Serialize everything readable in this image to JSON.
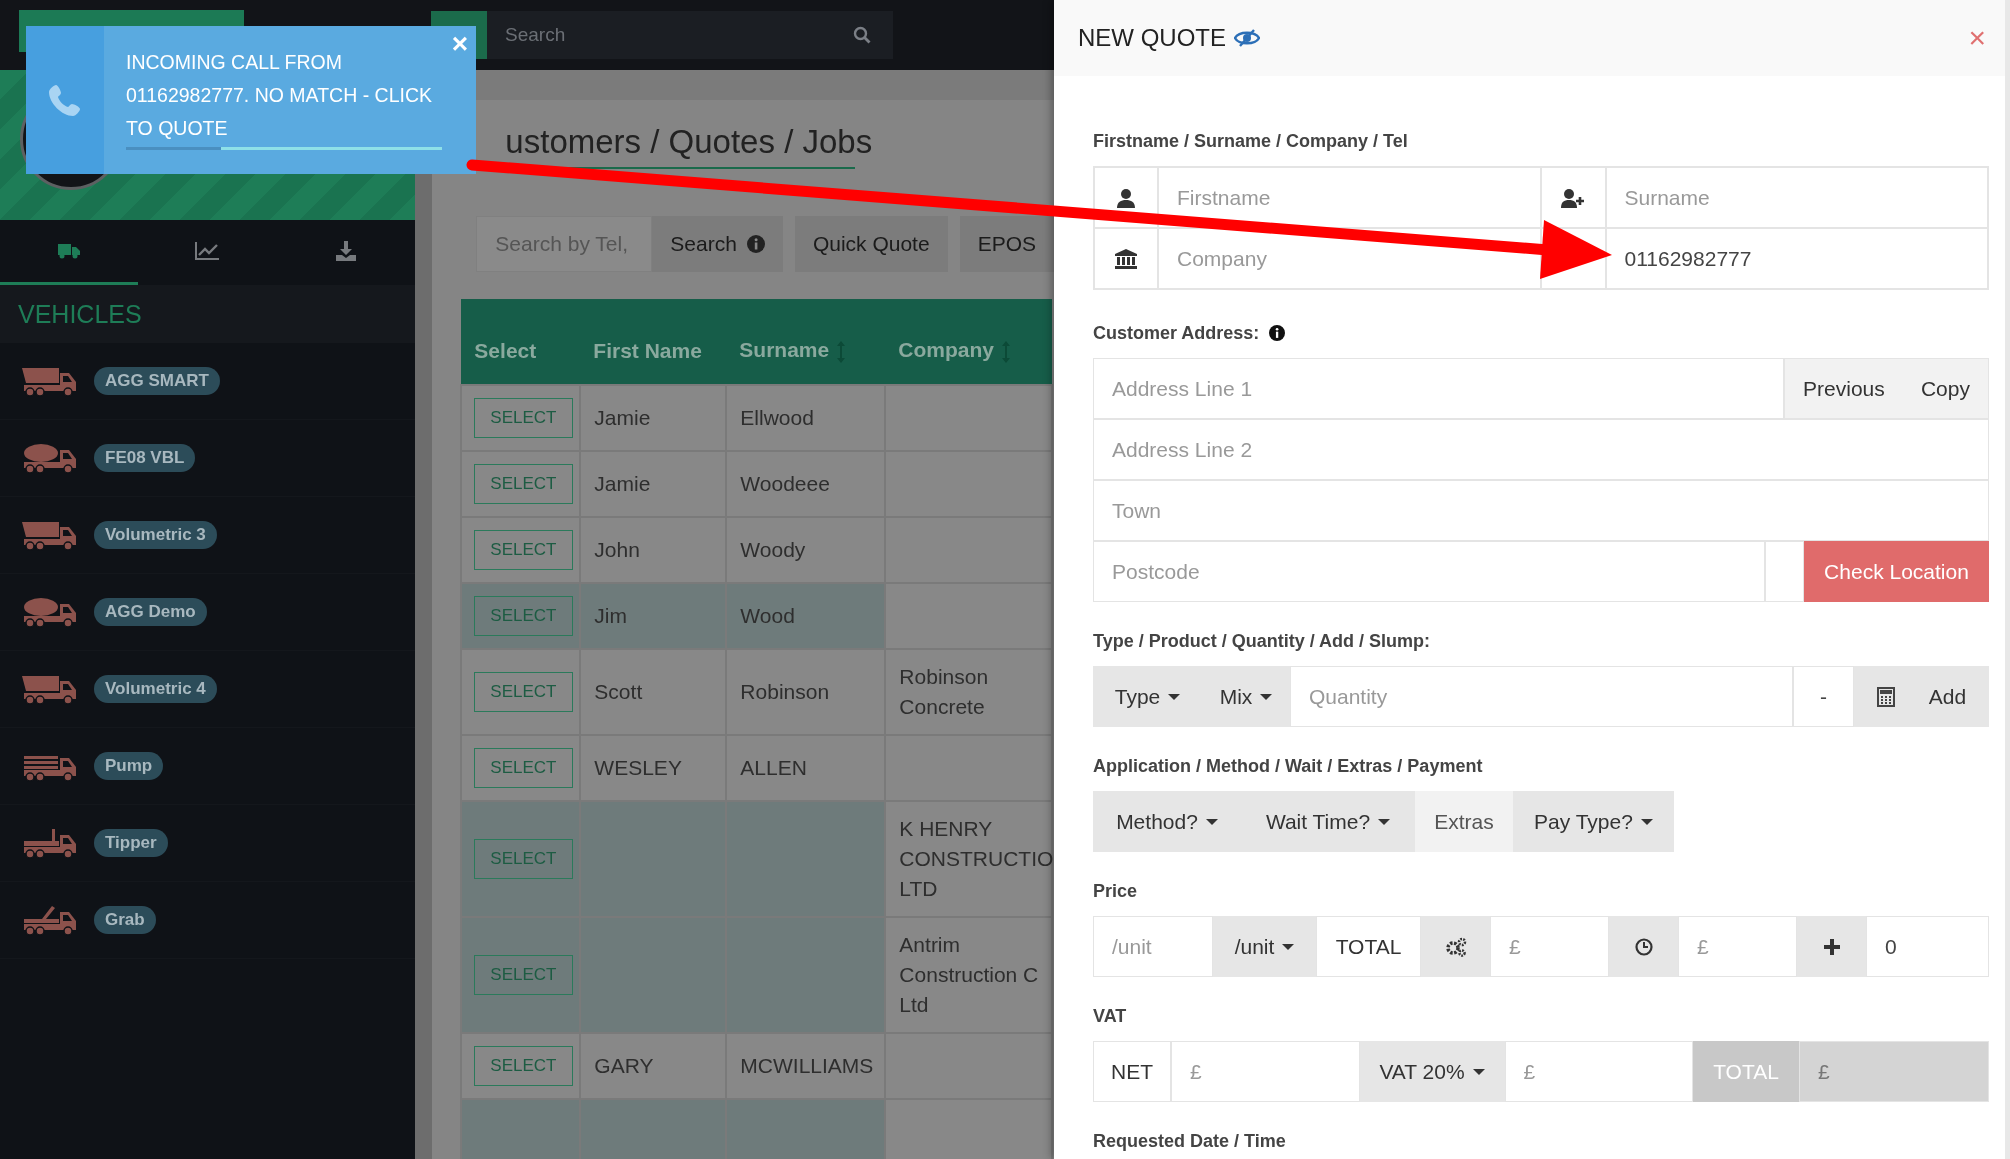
{
  "notification": {
    "message": "INCOMING CALL FROM 01162982777. NO MATCH - CLICK TO QUOTE",
    "close": "×",
    "level": 0.7
  },
  "topbar": {
    "search": {
      "placeholder": "Search"
    }
  },
  "sidebar": {
    "tabs": [
      {
        "selected": true
      },
      {
        "selected": false
      },
      {
        "selected": false
      }
    ],
    "heading": "VEHICLES",
    "vehicles": [
      {
        "name": "AGG SMART",
        "kind": "dump"
      },
      {
        "name": "FE08 VBL",
        "kind": "mixer"
      },
      {
        "name": "Volumetric 3",
        "kind": "dump"
      },
      {
        "name": "AGG Demo",
        "kind": "mixer"
      },
      {
        "name": "Volumetric 4",
        "kind": "dump"
      },
      {
        "name": "Pump",
        "kind": "pump"
      },
      {
        "name": "Tipper",
        "kind": "flatbed"
      },
      {
        "name": "Grab",
        "kind": "crane"
      }
    ]
  },
  "main": {
    "title": "ustomers / Quotes / Jobs",
    "search_field": {
      "placeholder": "Search by Tel,"
    },
    "search_button": "Search",
    "buttons": [
      "Quick Quote",
      "EPOS"
    ],
    "table": {
      "columns": [
        {
          "label": "Select",
          "sortable": false
        },
        {
          "label": "First Name",
          "sortable": false
        },
        {
          "label": "Surname",
          "sortable": true
        },
        {
          "label": "Company",
          "sortable": true
        }
      ],
      "rows": [
        {
          "button": "SELECT",
          "first_name": "Jamie",
          "surname": "Ellwood",
          "highlighted": false
        },
        {
          "button": "SELECT",
          "first_name": "Jamie",
          "surname": "Woodeee",
          "highlighted": false
        },
        {
          "button": "SELECT",
          "first_name": "John",
          "surname": "Woody",
          "highlighted": false
        },
        {
          "button": "SELECT",
          "first_name": "Jim",
          "surname": "Wood",
          "highlighted": true
        },
        {
          "button": "SELECT",
          "first_name": "Scott",
          "surname": "Robinson",
          "company": "Robinson\nConcrete",
          "highlighted": false
        },
        {
          "button": "SELECT",
          "first_name": "WESLEY",
          "surname": "ALLEN",
          "highlighted": false
        },
        {
          "button": "SELECT",
          "company": "K HENRY\nCONSTRUCTIO\nLTD",
          "highlighted": true
        },
        {
          "button": "SELECT",
          "company": "Antrim\nConstruction C\nLtd",
          "highlighted": true
        },
        {
          "button": "SELECT",
          "first_name": "GARY",
          "surname": "MCWILLIAMS",
          "highlighted": false
        },
        {
          "highlighted": true
        }
      ]
    }
  },
  "panel": {
    "title": "NEW QUOTE",
    "close": "×",
    "contact": {
      "label": "Firstname / Surname / Company / Tel",
      "firstname": {
        "placeholder": "Firstname"
      },
      "surname": {
        "placeholder": "Surname"
      },
      "company": {
        "placeholder": "Company"
      },
      "tel": {
        "value": "01162982777"
      }
    },
    "address": {
      "label": "Customer Address:",
      "line1": {
        "placeholder": "Address Line 1"
      },
      "previous": "Previous",
      "copy": "Copy",
      "line2": {
        "placeholder": "Address Line 2"
      },
      "town": {
        "placeholder": "Town"
      },
      "postcode": {
        "placeholder": "Postcode"
      },
      "check_location": "Check Location"
    },
    "product": {
      "label": "Type / Product / Quantity / Add / Slump:",
      "type": "Type",
      "mix": "Mix",
      "quantity": {
        "placeholder": "Quantity"
      },
      "minus": "-",
      "add": "Add"
    },
    "application": {
      "label": "Application / Method / Wait / Extras / Payment",
      "method": "Method?",
      "wait": "Wait Time?",
      "extras": "Extras",
      "pay_type": "Pay Type?"
    },
    "price": {
      "label": "Price",
      "unit_price": {
        "placeholder": "/unit"
      },
      "unit": "/unit",
      "total": "TOTAL",
      "extra_cost": {
        "placeholder": "£"
      },
      "wait_cost": {
        "placeholder": "£"
      },
      "adjustment": {
        "value": "0"
      }
    },
    "vat": {
      "label": "VAT",
      "net": "NET",
      "net_amount": {
        "placeholder": "£"
      },
      "rate": "VAT 20%",
      "vat_amount": {
        "placeholder": "£"
      },
      "total": "TOTAL",
      "total_amount": {
        "placeholder": "£",
        "disabled": true
      }
    },
    "requested": {
      "label": "Requested Date / Time"
    }
  }
}
